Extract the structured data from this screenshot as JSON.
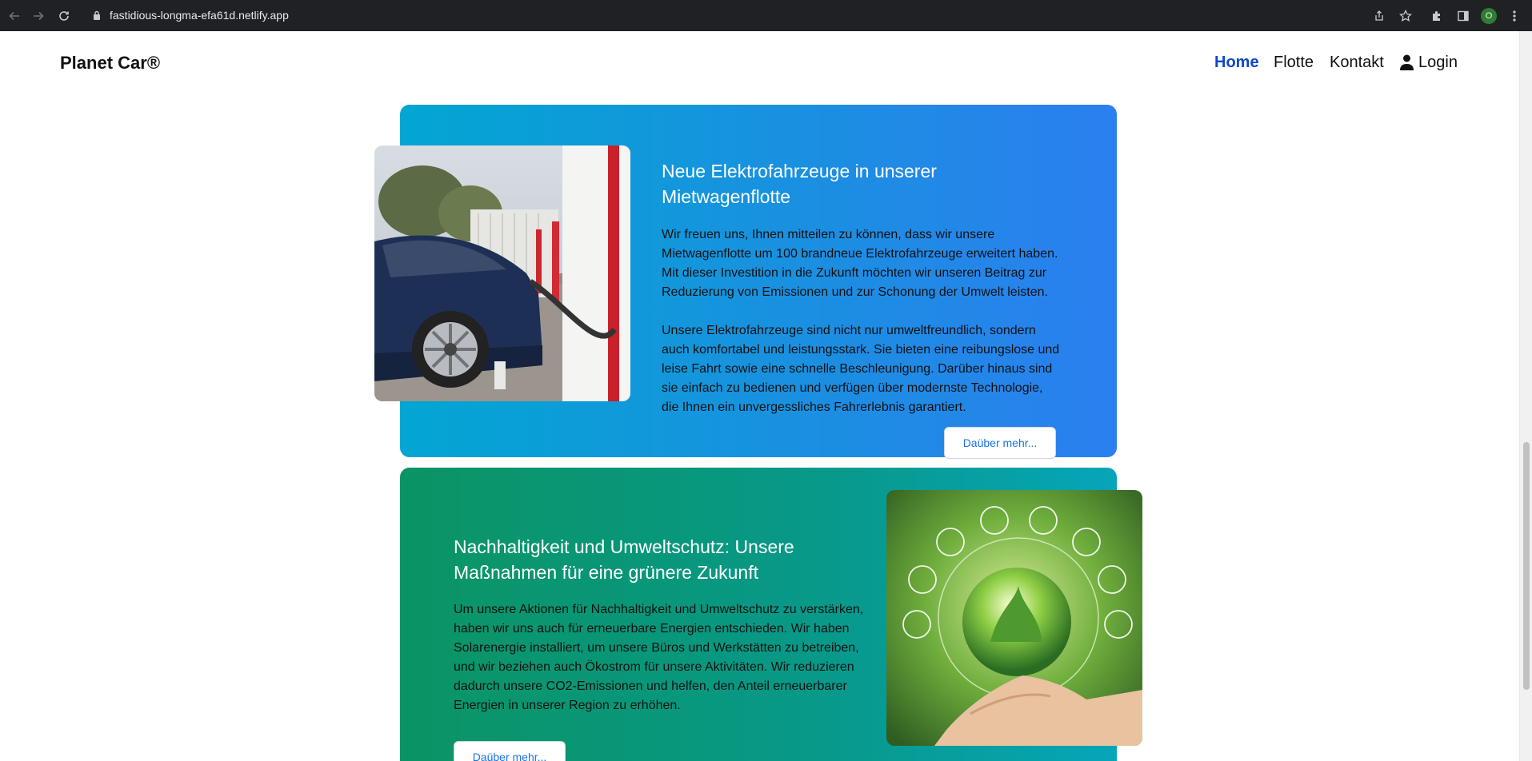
{
  "browser": {
    "url": "fastidious-longma-efa61d.netlify.app",
    "profile_initial": "O"
  },
  "navbar": {
    "brand": "Planet Car®",
    "links": [
      {
        "label": "Home",
        "active": true
      },
      {
        "label": "Flotte",
        "active": false
      },
      {
        "label": "Kontakt",
        "active": false
      },
      {
        "label": "Login",
        "active": false
      }
    ]
  },
  "cards": [
    {
      "title": "Neue Elektrofahrzeuge in unserer Mietwagenflotte",
      "paragraph1": "Wir freuen uns, Ihnen mitteilen zu können, dass wir unsere Mietwagenflotte um 100 brandneue Elektrofahrzeuge erweitert haben. Mit dieser Investition in die Zukunft möchten wir unseren Beitrag zur Reduzierung von Emissionen und zur Schonung der Umwelt leisten.",
      "paragraph2": "Unsere Elektrofahrzeuge sind nicht nur umweltfreundlich, sondern auch komfortabel und leistungsstark. Sie bieten eine reibungslose und leise Fahrt sowie eine schnelle Beschleunigung. Darüber hinaus sind sie einfach zu bedienen und verfügen über modernste Technologie, die Ihnen ein unvergessliches Fahrerlebnis garantiert.",
      "button": "Daüber mehr..."
    },
    {
      "title": "Nachhaltigkeit und Umweltschutz: Unsere Maßnahmen für eine grünere Zukunft",
      "paragraph1": "Um unsere Aktionen für Nachhaltigkeit und Umweltschutz zu verstärken, haben wir uns auch für erneuerbare Energien entschieden. Wir haben Solarenergie installiert, um unsere Büros und Werkstätten zu betreiben, und wir beziehen auch Ökostrom für unsere Aktivitäten. Wir reduzieren dadurch unsere CO2-Emissionen und helfen, den Anteil erneuerbarer Energien in unserer Region zu erhöhen.",
      "button": "Daüber mehr..."
    }
  ]
}
